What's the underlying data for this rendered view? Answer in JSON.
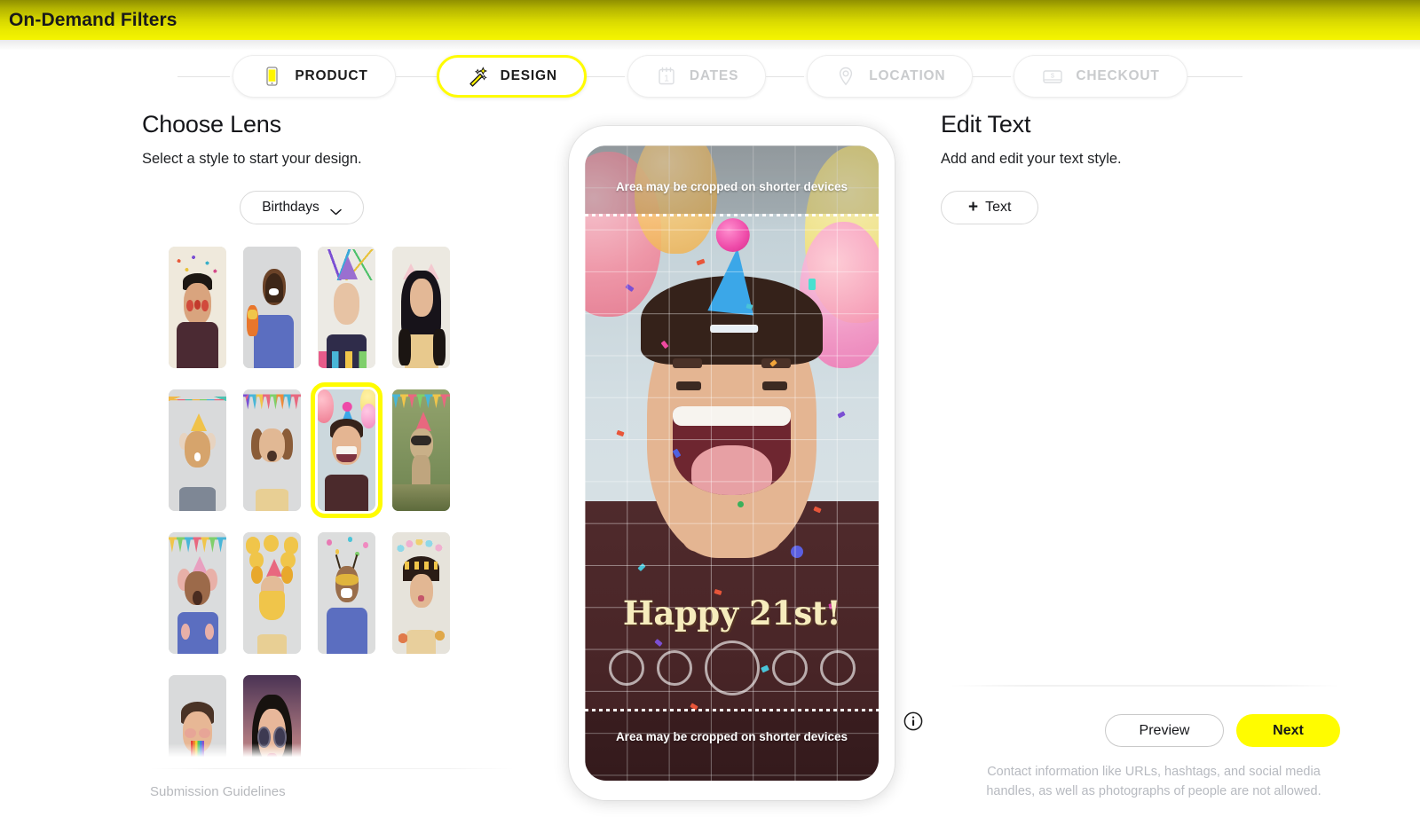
{
  "window": {
    "title": "On-Demand Filters"
  },
  "stepper": {
    "steps": [
      {
        "label": "PRODUCT",
        "icon": "phone-icon",
        "state": "complete"
      },
      {
        "label": "DESIGN",
        "icon": "magic-wand-icon",
        "state": "active"
      },
      {
        "label": "DATES",
        "icon": "calendar-icon",
        "state": "disabled"
      },
      {
        "label": "LOCATION",
        "icon": "map-pin-icon",
        "state": "disabled"
      },
      {
        "label": "CHECKOUT",
        "icon": "credit-card-icon",
        "state": "disabled"
      }
    ]
  },
  "left_panel": {
    "title": "Choose Lens",
    "subtitle": "Select a style to start your design.",
    "category_dropdown": {
      "value": "Birthdays",
      "icon": "chevron-down-icon"
    },
    "guidelines_link": "Submission Guidelines",
    "lenses": [
      {
        "name": "clown-confetti",
        "selected": false
      },
      {
        "name": "hotdog-dance",
        "selected": false
      },
      {
        "name": "party-streamers",
        "selected": false
      },
      {
        "name": "cat-ears",
        "selected": false
      },
      {
        "name": "deer-bunting",
        "selected": false
      },
      {
        "name": "puppy-bunting",
        "selected": false
      },
      {
        "name": "party-hat-balloons",
        "selected": true
      },
      {
        "name": "meerkat-party",
        "selected": false
      },
      {
        "name": "bear-bunting",
        "selected": false
      },
      {
        "name": "tiger-emoji",
        "selected": false
      },
      {
        "name": "bee-face",
        "selected": false
      },
      {
        "name": "star-crown",
        "selected": false
      },
      {
        "name": "rainbow-tongue",
        "selected": false
      },
      {
        "name": "sunglasses-glam",
        "selected": false
      }
    ]
  },
  "preview": {
    "crop_note_top": "Area may be cropped on shorter devices",
    "crop_note_bottom": "Area may be cropped on shorter devices",
    "overlay_text": "Happy 21st!",
    "info_icon": "info-icon"
  },
  "right_panel": {
    "title": "Edit Text",
    "subtitle": "Add and edit your text style.",
    "add_text_button": {
      "label": "Text",
      "plus": "+"
    },
    "preview_button": "Preview",
    "next_button": "Next",
    "disclaimer": "Contact information like URLs, hashtags, and social media handles, as well as photographs of people are not allowed."
  },
  "colors": {
    "brand_yellow": "#FFFC00",
    "header_gradient_top": "#8f8f00",
    "header_gradient_bottom": "#f4f400",
    "disabled_text": "#c9cbcd",
    "muted_text": "#b7bac0"
  }
}
